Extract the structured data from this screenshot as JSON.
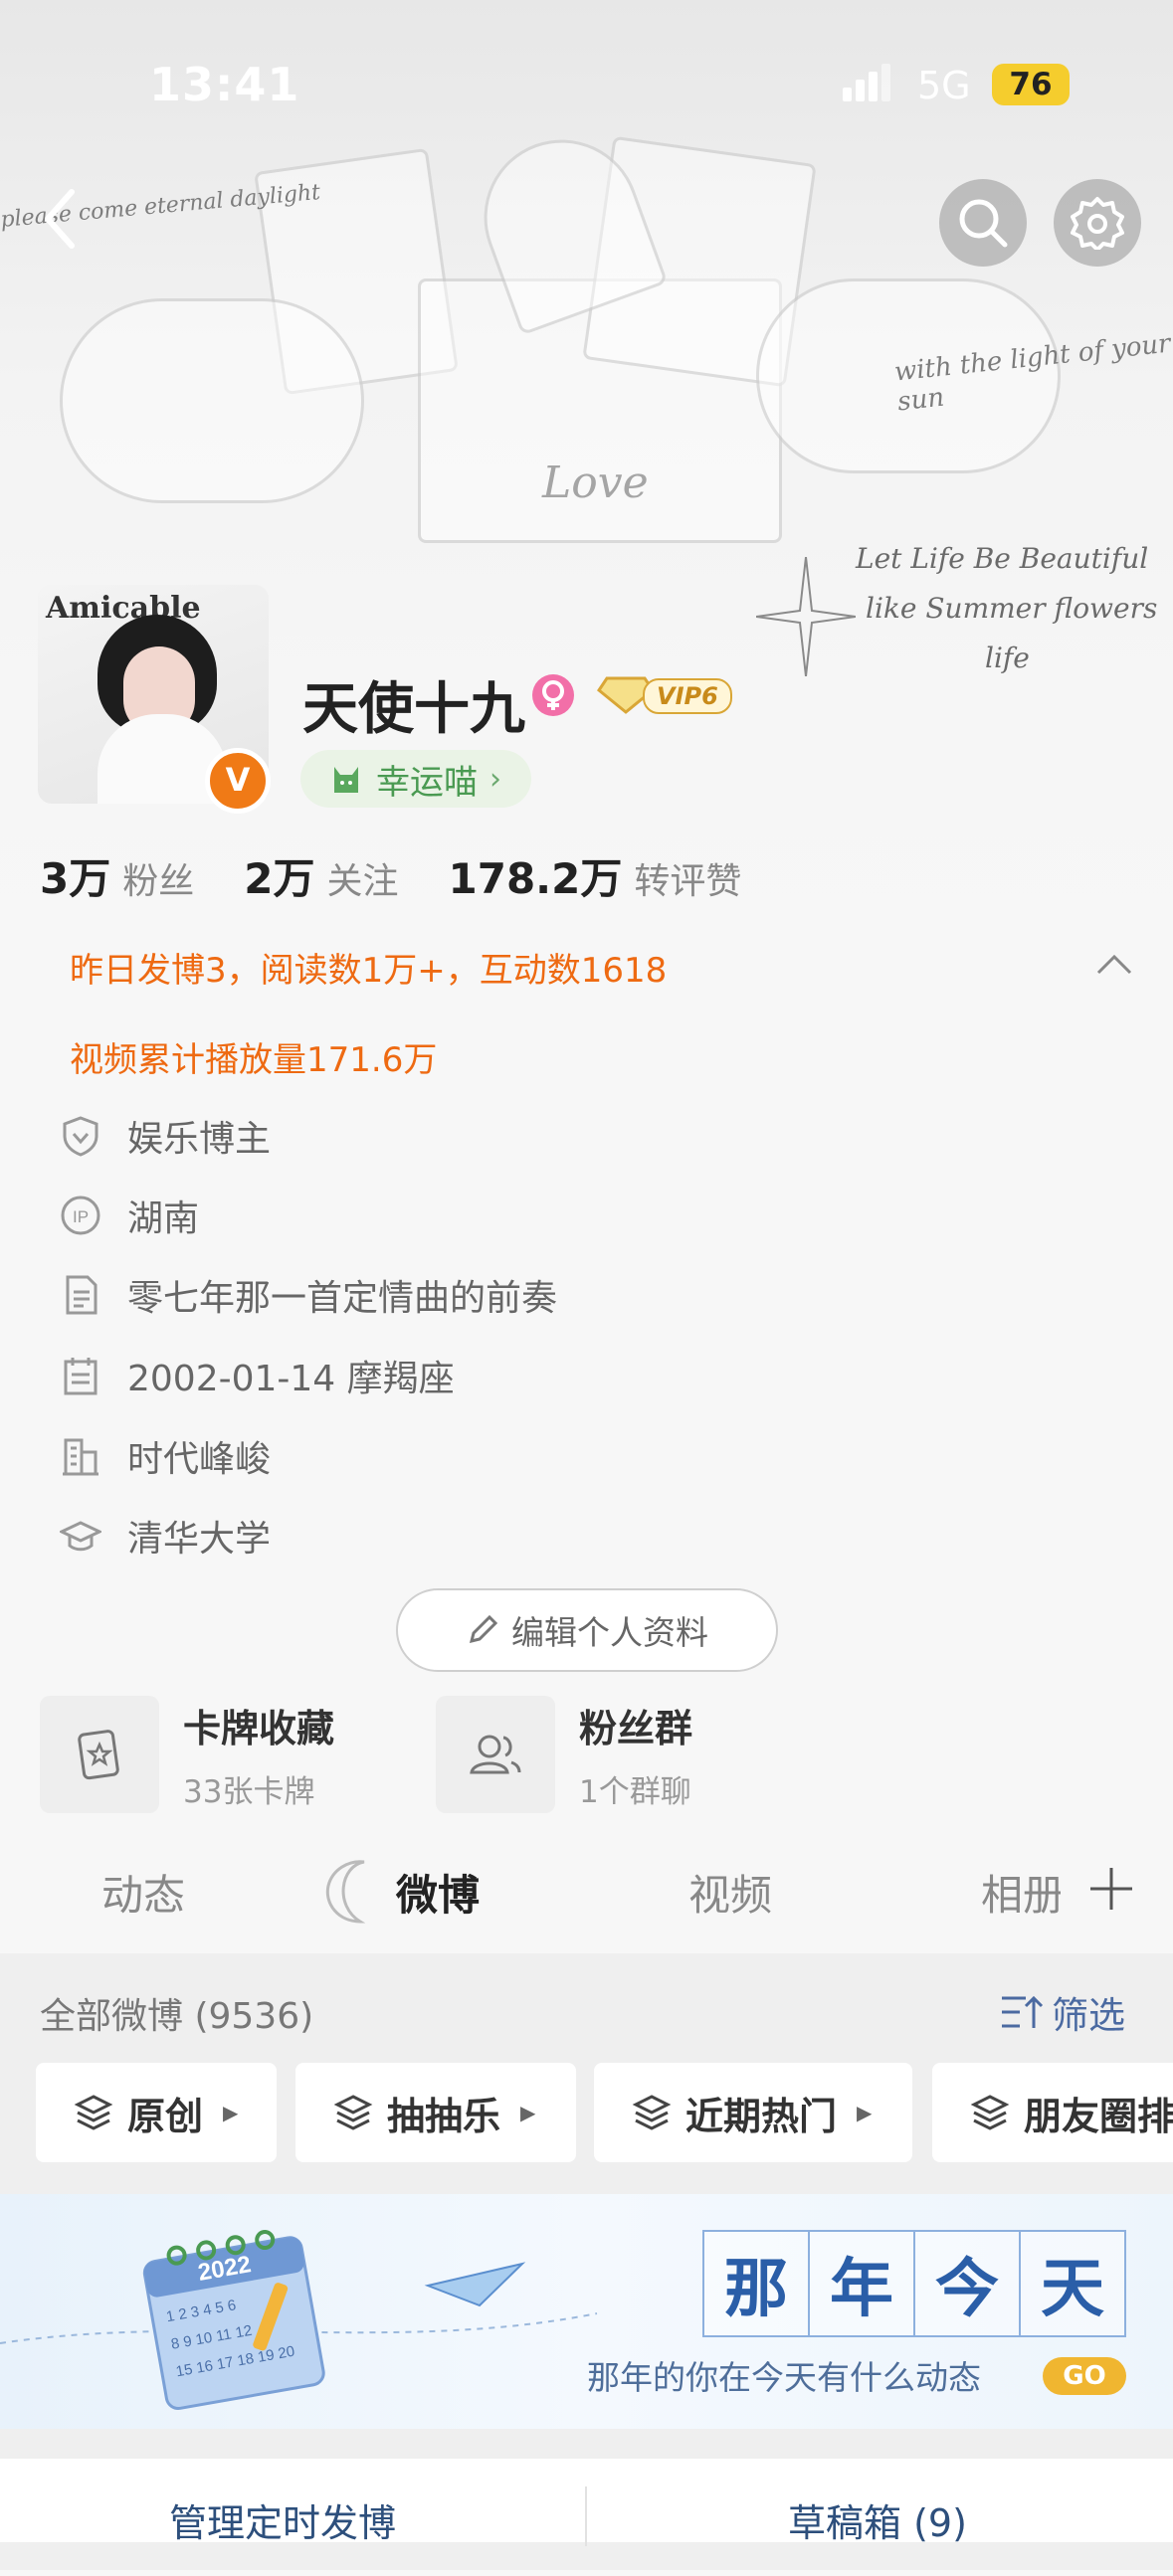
{
  "status_bar": {
    "time": "13:41",
    "network": "5G",
    "battery": "76"
  },
  "header_art": {
    "script_1": "please come eternal daylight",
    "script_2": "Love",
    "script_3": "with the light of your sun",
    "script_4": "Let Life Be Beautiful",
    "script_5": "like Summer flowers",
    "script_6": "life",
    "avatar_text": "Amicable"
  },
  "profile": {
    "name": "天使十九",
    "vip_label": "VIP6",
    "verified_mark": "V",
    "lucky_label": "幸运喵",
    "stats": [
      {
        "value": "3万",
        "label": "粉丝"
      },
      {
        "value": "2万",
        "label": "关注"
      },
      {
        "value": "178.2万",
        "label": "转评赞"
      }
    ]
  },
  "highlights": {
    "line1": "昨日发博3，阅读数1万+，互动数1618",
    "line2": "视频累计播放量171.6万"
  },
  "info": [
    {
      "icon": "shield-icon",
      "text": "娱乐博主"
    },
    {
      "icon": "ip-icon",
      "text": "湖南"
    },
    {
      "icon": "document-icon",
      "text": "零七年那一首定情曲的前奏"
    },
    {
      "icon": "calendar-icon",
      "text": "2002-01-14 摩羯座"
    },
    {
      "icon": "building-icon",
      "text": "时代峰峻"
    },
    {
      "icon": "graduation-cap-icon",
      "text": "清华大学"
    }
  ],
  "edit_profile_label": "编辑个人资料",
  "cards": [
    {
      "title": "卡牌收藏",
      "subtitle": "33张卡牌"
    },
    {
      "title": "粉丝群",
      "subtitle": "1个群聊"
    }
  ],
  "tabs": [
    "动态",
    "微博",
    "视频",
    "相册"
  ],
  "feed": {
    "all_label": "全部微博 (9536)",
    "filter_label": "筛选",
    "chips": [
      "原创",
      "抽抽乐",
      "近期热门",
      "朋友圈排"
    ]
  },
  "banner": {
    "title_chars": [
      "那",
      "年",
      "今",
      "天"
    ],
    "subtitle": "那年的你在今天有什么动态",
    "go_label": "GO",
    "calendar_year": "2022"
  },
  "bottom": {
    "schedule_label": "管理定时发博",
    "drafts_label": "草稿箱 (9)"
  },
  "colors": {
    "accent_orange": "#ee6a12",
    "link_blue": "#4b6aa1",
    "vip_gold": "#e0b23c",
    "lucky_green": "#4a9a52"
  }
}
